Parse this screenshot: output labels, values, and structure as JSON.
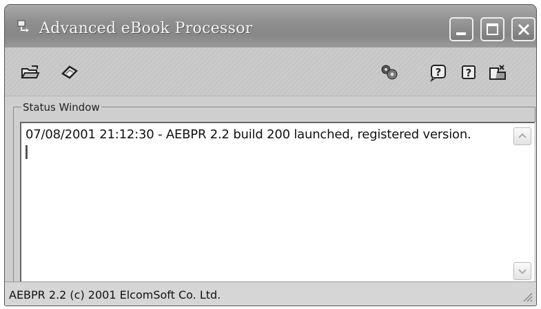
{
  "window": {
    "title": "Advanced eBook Processor"
  },
  "titlebar_buttons": [
    "minimize-button",
    "maximize-button",
    "close-button"
  ],
  "toolbar": {
    "items": [
      {
        "name": "open-icon"
      },
      {
        "name": "decrypt-icon"
      },
      {
        "name": "settings-icon"
      },
      {
        "name": "help-contents-icon"
      },
      {
        "name": "help-icon"
      },
      {
        "name": "exit-icon"
      }
    ]
  },
  "status_window": {
    "legend": "Status Window",
    "log_lines": [
      "07/08/2001 21:12:30 - AEBPR 2.2 build 200 launched, registered version."
    ]
  },
  "statusbar": {
    "text": "AEBPR 2.2 (c) 2001 ElcomSoft Co. Ltd."
  }
}
